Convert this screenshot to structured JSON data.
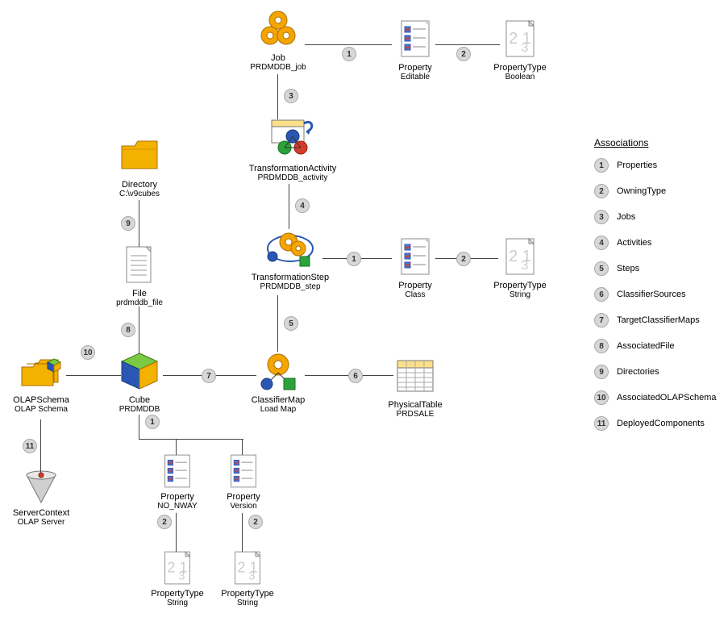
{
  "nodes": {
    "job": {
      "title": "Job",
      "sub": "PRDMDDB_job"
    },
    "propEditable": {
      "title": "Property",
      "sub": "Editable"
    },
    "ptBoolean": {
      "title": "PropertyType",
      "sub": "Boolean"
    },
    "tActivity": {
      "title": "TransformationActivity",
      "sub": "PRDMDDB_activity"
    },
    "directory": {
      "title": "Directory",
      "sub": "C:\\v9cubes"
    },
    "tStep": {
      "title": "TransformationStep",
      "sub": "PRDMDDB_step"
    },
    "propClass": {
      "title": "Property",
      "sub": "Class"
    },
    "ptString1": {
      "title": "PropertyType",
      "sub": "String"
    },
    "file": {
      "title": "File",
      "sub": "prdmddb_file"
    },
    "olapSchema": {
      "title": "OLAPSchema",
      "sub": "OLAP Schema"
    },
    "cube": {
      "title": "Cube",
      "sub": "PRDMDDB"
    },
    "classifierMap": {
      "title": "ClassifierMap",
      "sub": "Load Map"
    },
    "physTable": {
      "title": "PhysicalTable",
      "sub": "PRDSALE"
    },
    "serverCtx": {
      "title": "ServerContext",
      "sub": "OLAP Server"
    },
    "propNoNway": {
      "title": "Property",
      "sub": "NO_NWAY"
    },
    "propVersion": {
      "title": "Property",
      "sub": "Version"
    },
    "ptString2": {
      "title": "PropertyType",
      "sub": "String"
    },
    "ptString3": {
      "title": "PropertyType",
      "sub": "String"
    }
  },
  "legend": {
    "header": "Associations",
    "items": [
      {
        "n": "1",
        "label": "Properties"
      },
      {
        "n": "2",
        "label": "OwningType"
      },
      {
        "n": "3",
        "label": "Jobs"
      },
      {
        "n": "4",
        "label": "Activities"
      },
      {
        "n": "5",
        "label": "Steps"
      },
      {
        "n": "6",
        "label": "ClassifierSources"
      },
      {
        "n": "7",
        "label": "TargetClassifierMaps"
      },
      {
        "n": "8",
        "label": "AssociatedFile"
      },
      {
        "n": "9",
        "label": "Directories"
      },
      {
        "n": "10",
        "label": "AssociatedOLAPSchema"
      },
      {
        "n": "11",
        "label": "DeployedComponents"
      }
    ]
  }
}
